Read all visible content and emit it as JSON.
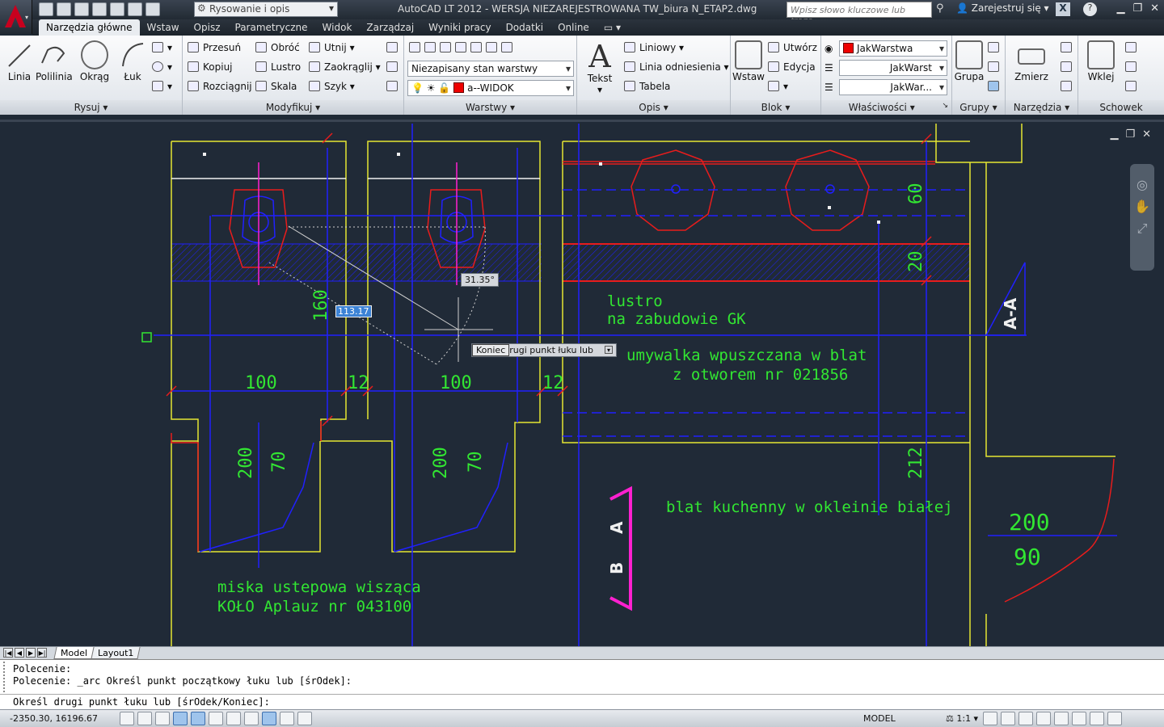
{
  "title_bar": {
    "workspace": "Rysowanie i opis",
    "title": "AutoCAD LT 2012 - WERSJA NIEZAREJESTROWANA    TW_biura N_ETAP2.dwg",
    "search_placeholder": "Wpisz słowo kluczowe lub frazę",
    "signin": "Zarejestruj się"
  },
  "tabs": [
    "Narzędzia główne",
    "Wstaw",
    "Opisz",
    "Parametryczne",
    "Widok",
    "Zarządzaj",
    "Wyniki pracy",
    "Dodatki",
    "Online"
  ],
  "ribbon": {
    "draw": {
      "title": "Rysuj",
      "linia": "Linia",
      "polilinia": "Polilinia",
      "okrag": "Okrąg",
      "luk": "Łuk"
    },
    "modify": {
      "title": "Modyfikuj",
      "przesun": "Przesuń",
      "obroc": "Obróć",
      "utnij": "Utnij",
      "kopiuj": "Kopiuj",
      "lustro": "Lustro",
      "zaokraglij": "Zaokrąglij",
      "rozciagnij": "Rozciągnij",
      "skala": "Skala",
      "szyk": "Szyk"
    },
    "layers": {
      "title": "Warstwy",
      "state": "Niezapisany stan warstwy",
      "current": "a--WIDOK"
    },
    "annotation": {
      "title": "Opis",
      "tekst": "Tekst",
      "liniowy": "Liniowy",
      "linia_odniesienia": "Linia odniesienia",
      "tabela": "Tabela"
    },
    "block": {
      "title": "Blok",
      "wstaw": "Wstaw",
      "utworz": "Utwórz",
      "edycja": "Edycja"
    },
    "properties": {
      "title": "Właściwości",
      "color": "JakWarstwa",
      "linetype": "JakWarst",
      "lineweight": "JakWar..."
    },
    "groups": {
      "title": "Grupy",
      "grupa": "Grupa"
    },
    "utilities": {
      "title": "Narzędzia",
      "zmierz": "Zmierz"
    },
    "clipboard": {
      "title": "Schowek",
      "wklej": "Wklej"
    }
  },
  "drawing": {
    "dims": {
      "d100a": "100",
      "d12a": "12",
      "d100b": "100",
      "d12b": "12",
      "d160": "160",
      "d200a": "200",
      "d70a": "70",
      "d200b": "200",
      "d70b": "70",
      "d60": "60",
      "d20": "20",
      "d212": "212",
      "d200c": "200",
      "d90": "90"
    },
    "labels": {
      "lustro1": "lustro",
      "lustro2": "na zabudowie GK",
      "umyw1": "umywalka wpuszczana w blat",
      "umyw2": "z otworem nr 021856",
      "blat": "blat kuchenny w okleinie białej",
      "miska1": "miska ustepowa wisząca",
      "miska2": "KOŁO Aplauz nr 043100",
      "section": "A-A",
      "sec_a": "A",
      "sec_b": "B"
    },
    "angle_tip": "31.35°",
    "length_input": "113.17",
    "option_tip_first": "Koniec",
    "option_tip_text": "rugi punkt łuku lub"
  },
  "layout_tabs": [
    "Model",
    "Layout1"
  ],
  "command": {
    "line1": "Polecenie:",
    "line2": "Polecenie: _arc Określ punkt początkowy łuku lub [śrOdek]:",
    "current": "Określ drugi punkt łuku lub [śrOdek/Koniec]:"
  },
  "status": {
    "coords": "-2350.30, 16196.67",
    "model": "MODEL",
    "scale": "1:1"
  },
  "colors": {
    "canvas": "#202a37",
    "cad_green": "#32e632",
    "cad_blue": "#2020ff",
    "cad_red": "#e81c1c",
    "cad_yellow": "#e6e632",
    "cad_magenta": "#ff20d0",
    "cad_white": "#f0f0f0"
  }
}
